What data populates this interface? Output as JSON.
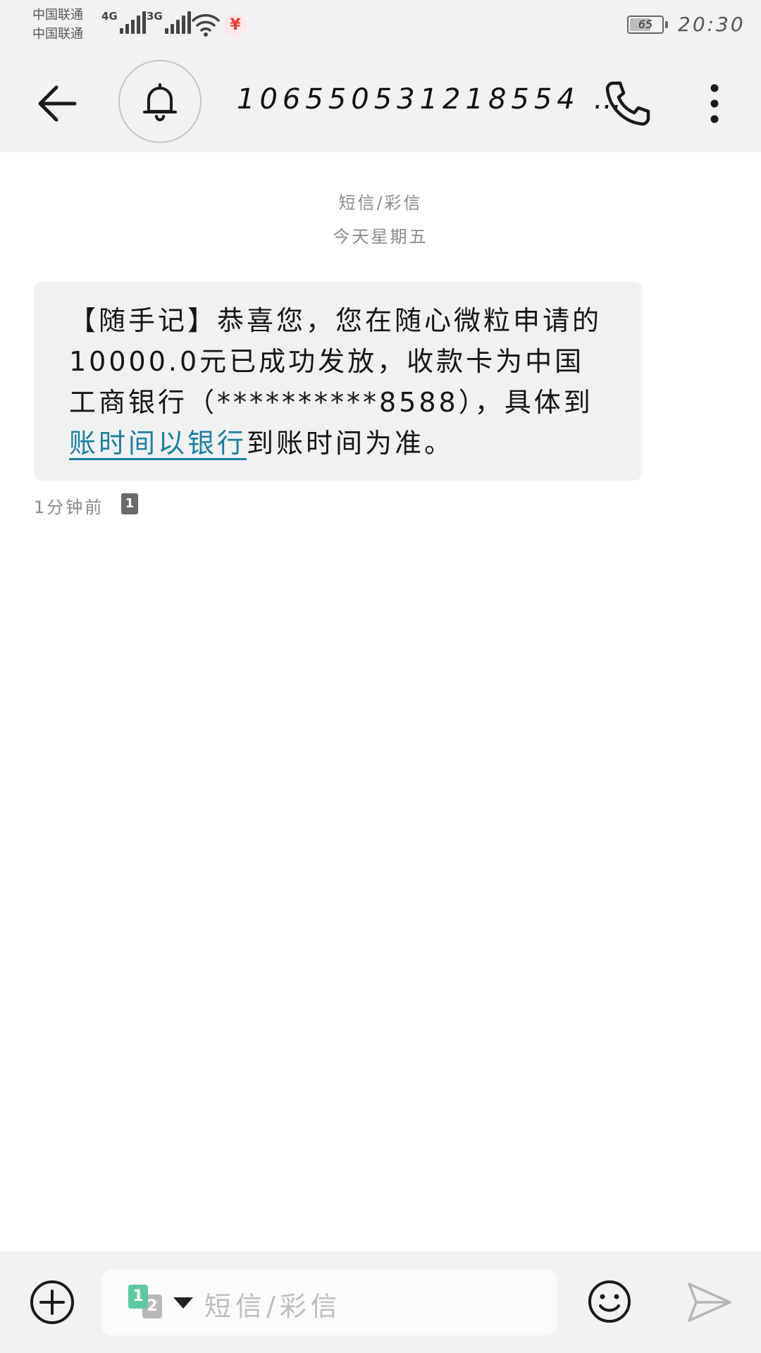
{
  "status_bar": {
    "carrier_1": "中国联通",
    "carrier_2": "中国联通",
    "network_1": "4G",
    "network_2": "3G",
    "payment_badge": "¥",
    "battery_level": "65",
    "battery_fraction": 0.65,
    "time": "20:30"
  },
  "header": {
    "contact_number": "1065505312185​54 …"
  },
  "conversation": {
    "message_type_label": "短信/彩信",
    "date_label": "今天星期五",
    "message": {
      "text_before_link": "【随手记】恭喜您，您在随心微粒申请的10000.0元已成功发放，收款卡为中国工商银行（**********8588），具体到",
      "link_text": "账时间以银行",
      "text_after_link": "到账时间为准。"
    },
    "message_time": "1分钟前",
    "sim_badge": "1"
  },
  "composer": {
    "sim_primary": "1",
    "sim_secondary": "2",
    "placeholder": "短信/彩信"
  },
  "colors": {
    "bar_background": "#f2f2f2",
    "bubble_background": "#f1f1f1",
    "link": "#1a7fa0",
    "sim1_accent": "#5ec9a0",
    "payment_red": "#e53935"
  },
  "icons": {
    "back": "arrow-left-icon",
    "notification": "bell-icon",
    "call": "phone-icon",
    "more": "more-vertical-icon",
    "add": "plus-circle-icon",
    "emoji": "smiley-icon",
    "send": "send-icon"
  }
}
